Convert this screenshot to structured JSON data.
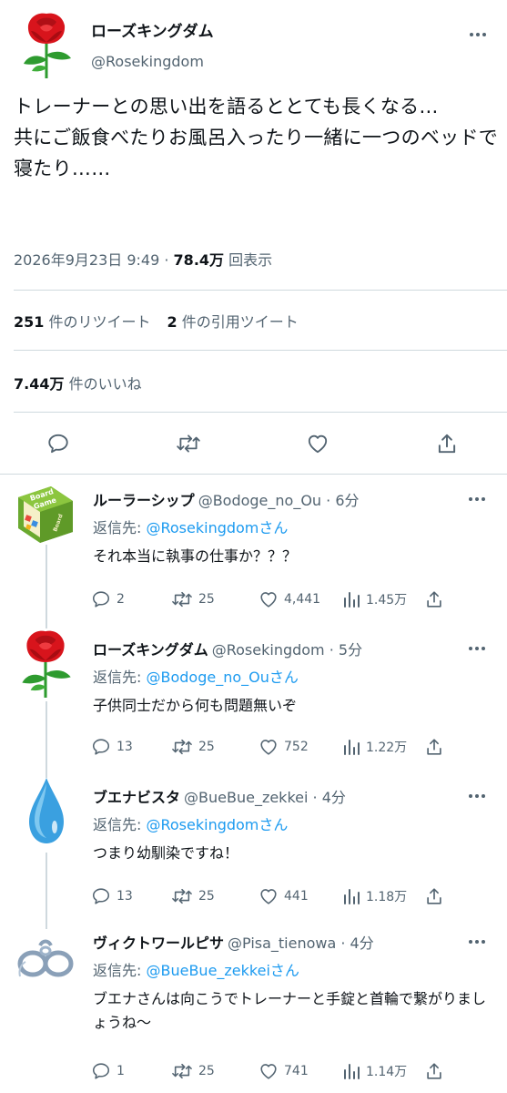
{
  "tweet": {
    "display_name": "ローズキングダム",
    "handle": "@Rosekingdom",
    "text": "トレーナーとの思い出を語るととても長くなる…\n共にご飯食べたりお風呂入ったり一緒に一つのベッドで寝たり……",
    "date": "2026年9月23日 9:49 · ",
    "views_count": "78.4万",
    "views_label": " 回表示",
    "retweets_count": "251",
    "retweets_label": " 件のリツイート",
    "quotes_count": "2",
    "quotes_label": " 件の引用ツイート",
    "likes_count": "7.44万",
    "likes_label": " 件のいいね"
  },
  "replies": [
    {
      "display_name": "ルーラーシップ",
      "handle": "@Bodoge_no_Ou · 6分",
      "reply_to_label": "返信先: ",
      "reply_to_user": "@Rosekingdomさん",
      "text": "それ本当に執事の仕事か？？？",
      "avatar_text_1": "Board",
      "avatar_text_2": "Game",
      "replies": "2",
      "retweets": "25",
      "likes": "4,441",
      "views": "1.45万"
    },
    {
      "display_name": "ローズキングダム",
      "handle": "@Rosekingdom · 5分",
      "reply_to_label": "返信先: ",
      "reply_to_user": "@Bodoge_no_Ouさん",
      "text": "子供同士だから何も問題無いぞ",
      "replies": "13",
      "retweets": "25",
      "likes": "752",
      "views": "1.22万"
    },
    {
      "display_name": "ブエナビスタ",
      "handle": "@BueBue_zekkei · 4分",
      "reply_to_label": "返信先: ",
      "reply_to_user": "@Rosekingdomさん",
      "text": "つまり幼馴染ですね！",
      "replies": "13",
      "retweets": "25",
      "likes": "441",
      "views": "1.18万"
    },
    {
      "display_name": "ヴィクトワールピサ",
      "handle": "@Pisa_tienowa · 4分",
      "reply_to_label": "返信先: ",
      "reply_to_user": "@BueBue_zekkeiさん",
      "text": "ブエナさんは向こうでトレーナーと手錠と首輪で繋がりましょうね～",
      "replies": "1",
      "retweets": "25",
      "likes": "741",
      "views": "1.14万"
    }
  ],
  "colors": {
    "text_primary": "#0f1419",
    "text_secondary": "#536471",
    "link": "#1d9bf0",
    "divider": "#cfd9de",
    "rose_red": "#d8141c",
    "leaf_green": "#2e9b2f",
    "board_game_green": "#8cc63f",
    "water_drop": "#3aa0e0",
    "chain_gray": "#8aa0b8"
  },
  "icons": {
    "reply": "reply-icon",
    "retweet": "retweet-icon",
    "like": "heart-icon",
    "views": "views-icon",
    "share": "share-icon",
    "more": "more-icon"
  }
}
